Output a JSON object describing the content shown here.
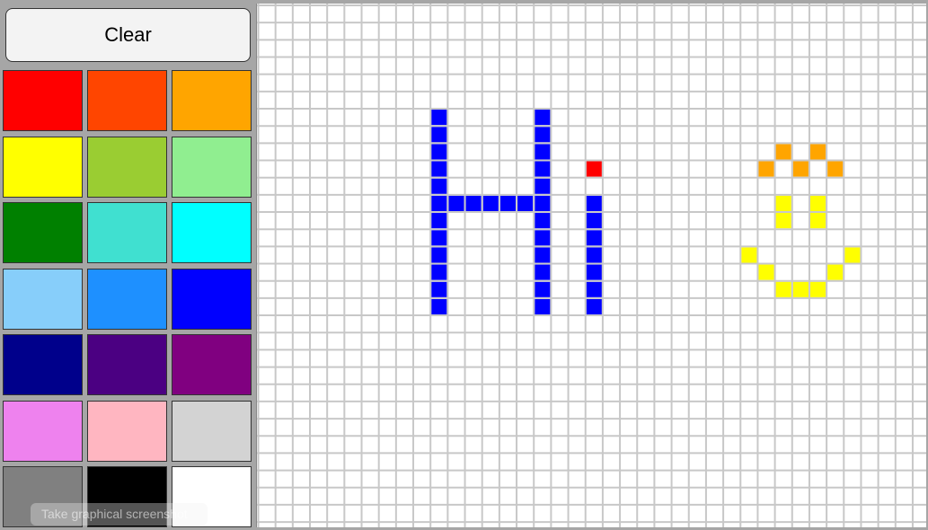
{
  "toolbar": {
    "clear_label": "Clear"
  },
  "tooltip": {
    "text": "Take graphical screenshot"
  },
  "palette": {
    "colors": [
      "#ff0000",
      "#ff4500",
      "#ffa500",
      "#ffff00",
      "#9acd32",
      "#90ee90",
      "#008000",
      "#40e0d0",
      "#00ffff",
      "#87cefa",
      "#1e90ff",
      "#0000ff",
      "#00008b",
      "#4b0082",
      "#800080",
      "#ee82ee",
      "#ffb6c1",
      "#d3d3d3",
      "#808080",
      "#000000",
      "#ffffff"
    ]
  },
  "canvas": {
    "columns": 39,
    "rows": 30,
    "background": "#ffffff",
    "grid_color": "#c8c8c8",
    "painted_cells": [
      {
        "c": 10,
        "r": 6,
        "color": "#0000ff"
      },
      {
        "c": 16,
        "r": 6,
        "color": "#0000ff"
      },
      {
        "c": 10,
        "r": 7,
        "color": "#0000ff"
      },
      {
        "c": 16,
        "r": 7,
        "color": "#0000ff"
      },
      {
        "c": 10,
        "r": 8,
        "color": "#0000ff"
      },
      {
        "c": 16,
        "r": 8,
        "color": "#0000ff"
      },
      {
        "c": 10,
        "r": 9,
        "color": "#0000ff"
      },
      {
        "c": 16,
        "r": 9,
        "color": "#0000ff"
      },
      {
        "c": 10,
        "r": 10,
        "color": "#0000ff"
      },
      {
        "c": 16,
        "r": 10,
        "color": "#0000ff"
      },
      {
        "c": 10,
        "r": 11,
        "color": "#0000ff"
      },
      {
        "c": 11,
        "r": 11,
        "color": "#0000ff"
      },
      {
        "c": 12,
        "r": 11,
        "color": "#0000ff"
      },
      {
        "c": 13,
        "r": 11,
        "color": "#0000ff"
      },
      {
        "c": 14,
        "r": 11,
        "color": "#0000ff"
      },
      {
        "c": 15,
        "r": 11,
        "color": "#0000ff"
      },
      {
        "c": 16,
        "r": 11,
        "color": "#0000ff"
      },
      {
        "c": 10,
        "r": 12,
        "color": "#0000ff"
      },
      {
        "c": 16,
        "r": 12,
        "color": "#0000ff"
      },
      {
        "c": 10,
        "r": 13,
        "color": "#0000ff"
      },
      {
        "c": 16,
        "r": 13,
        "color": "#0000ff"
      },
      {
        "c": 10,
        "r": 14,
        "color": "#0000ff"
      },
      {
        "c": 16,
        "r": 14,
        "color": "#0000ff"
      },
      {
        "c": 10,
        "r": 15,
        "color": "#0000ff"
      },
      {
        "c": 16,
        "r": 15,
        "color": "#0000ff"
      },
      {
        "c": 10,
        "r": 16,
        "color": "#0000ff"
      },
      {
        "c": 16,
        "r": 16,
        "color": "#0000ff"
      },
      {
        "c": 10,
        "r": 17,
        "color": "#0000ff"
      },
      {
        "c": 16,
        "r": 17,
        "color": "#0000ff"
      },
      {
        "c": 19,
        "r": 9,
        "color": "#ff0000"
      },
      {
        "c": 19,
        "r": 11,
        "color": "#0000ff"
      },
      {
        "c": 19,
        "r": 12,
        "color": "#0000ff"
      },
      {
        "c": 19,
        "r": 13,
        "color": "#0000ff"
      },
      {
        "c": 19,
        "r": 14,
        "color": "#0000ff"
      },
      {
        "c": 19,
        "r": 15,
        "color": "#0000ff"
      },
      {
        "c": 19,
        "r": 16,
        "color": "#0000ff"
      },
      {
        "c": 19,
        "r": 17,
        "color": "#0000ff"
      },
      {
        "c": 30,
        "r": 8,
        "color": "#ffa500"
      },
      {
        "c": 32,
        "r": 8,
        "color": "#ffa500"
      },
      {
        "c": 29,
        "r": 9,
        "color": "#ffa500"
      },
      {
        "c": 31,
        "r": 9,
        "color": "#ffa500"
      },
      {
        "c": 33,
        "r": 9,
        "color": "#ffa500"
      },
      {
        "c": 30,
        "r": 11,
        "color": "#ffff00"
      },
      {
        "c": 32,
        "r": 11,
        "color": "#ffff00"
      },
      {
        "c": 30,
        "r": 12,
        "color": "#ffff00"
      },
      {
        "c": 32,
        "r": 12,
        "color": "#ffff00"
      },
      {
        "c": 28,
        "r": 14,
        "color": "#ffff00"
      },
      {
        "c": 34,
        "r": 14,
        "color": "#ffff00"
      },
      {
        "c": 29,
        "r": 15,
        "color": "#ffff00"
      },
      {
        "c": 33,
        "r": 15,
        "color": "#ffff00"
      },
      {
        "c": 30,
        "r": 16,
        "color": "#ffff00"
      },
      {
        "c": 31,
        "r": 16,
        "color": "#ffff00"
      },
      {
        "c": 32,
        "r": 16,
        "color": "#ffff00"
      }
    ]
  }
}
